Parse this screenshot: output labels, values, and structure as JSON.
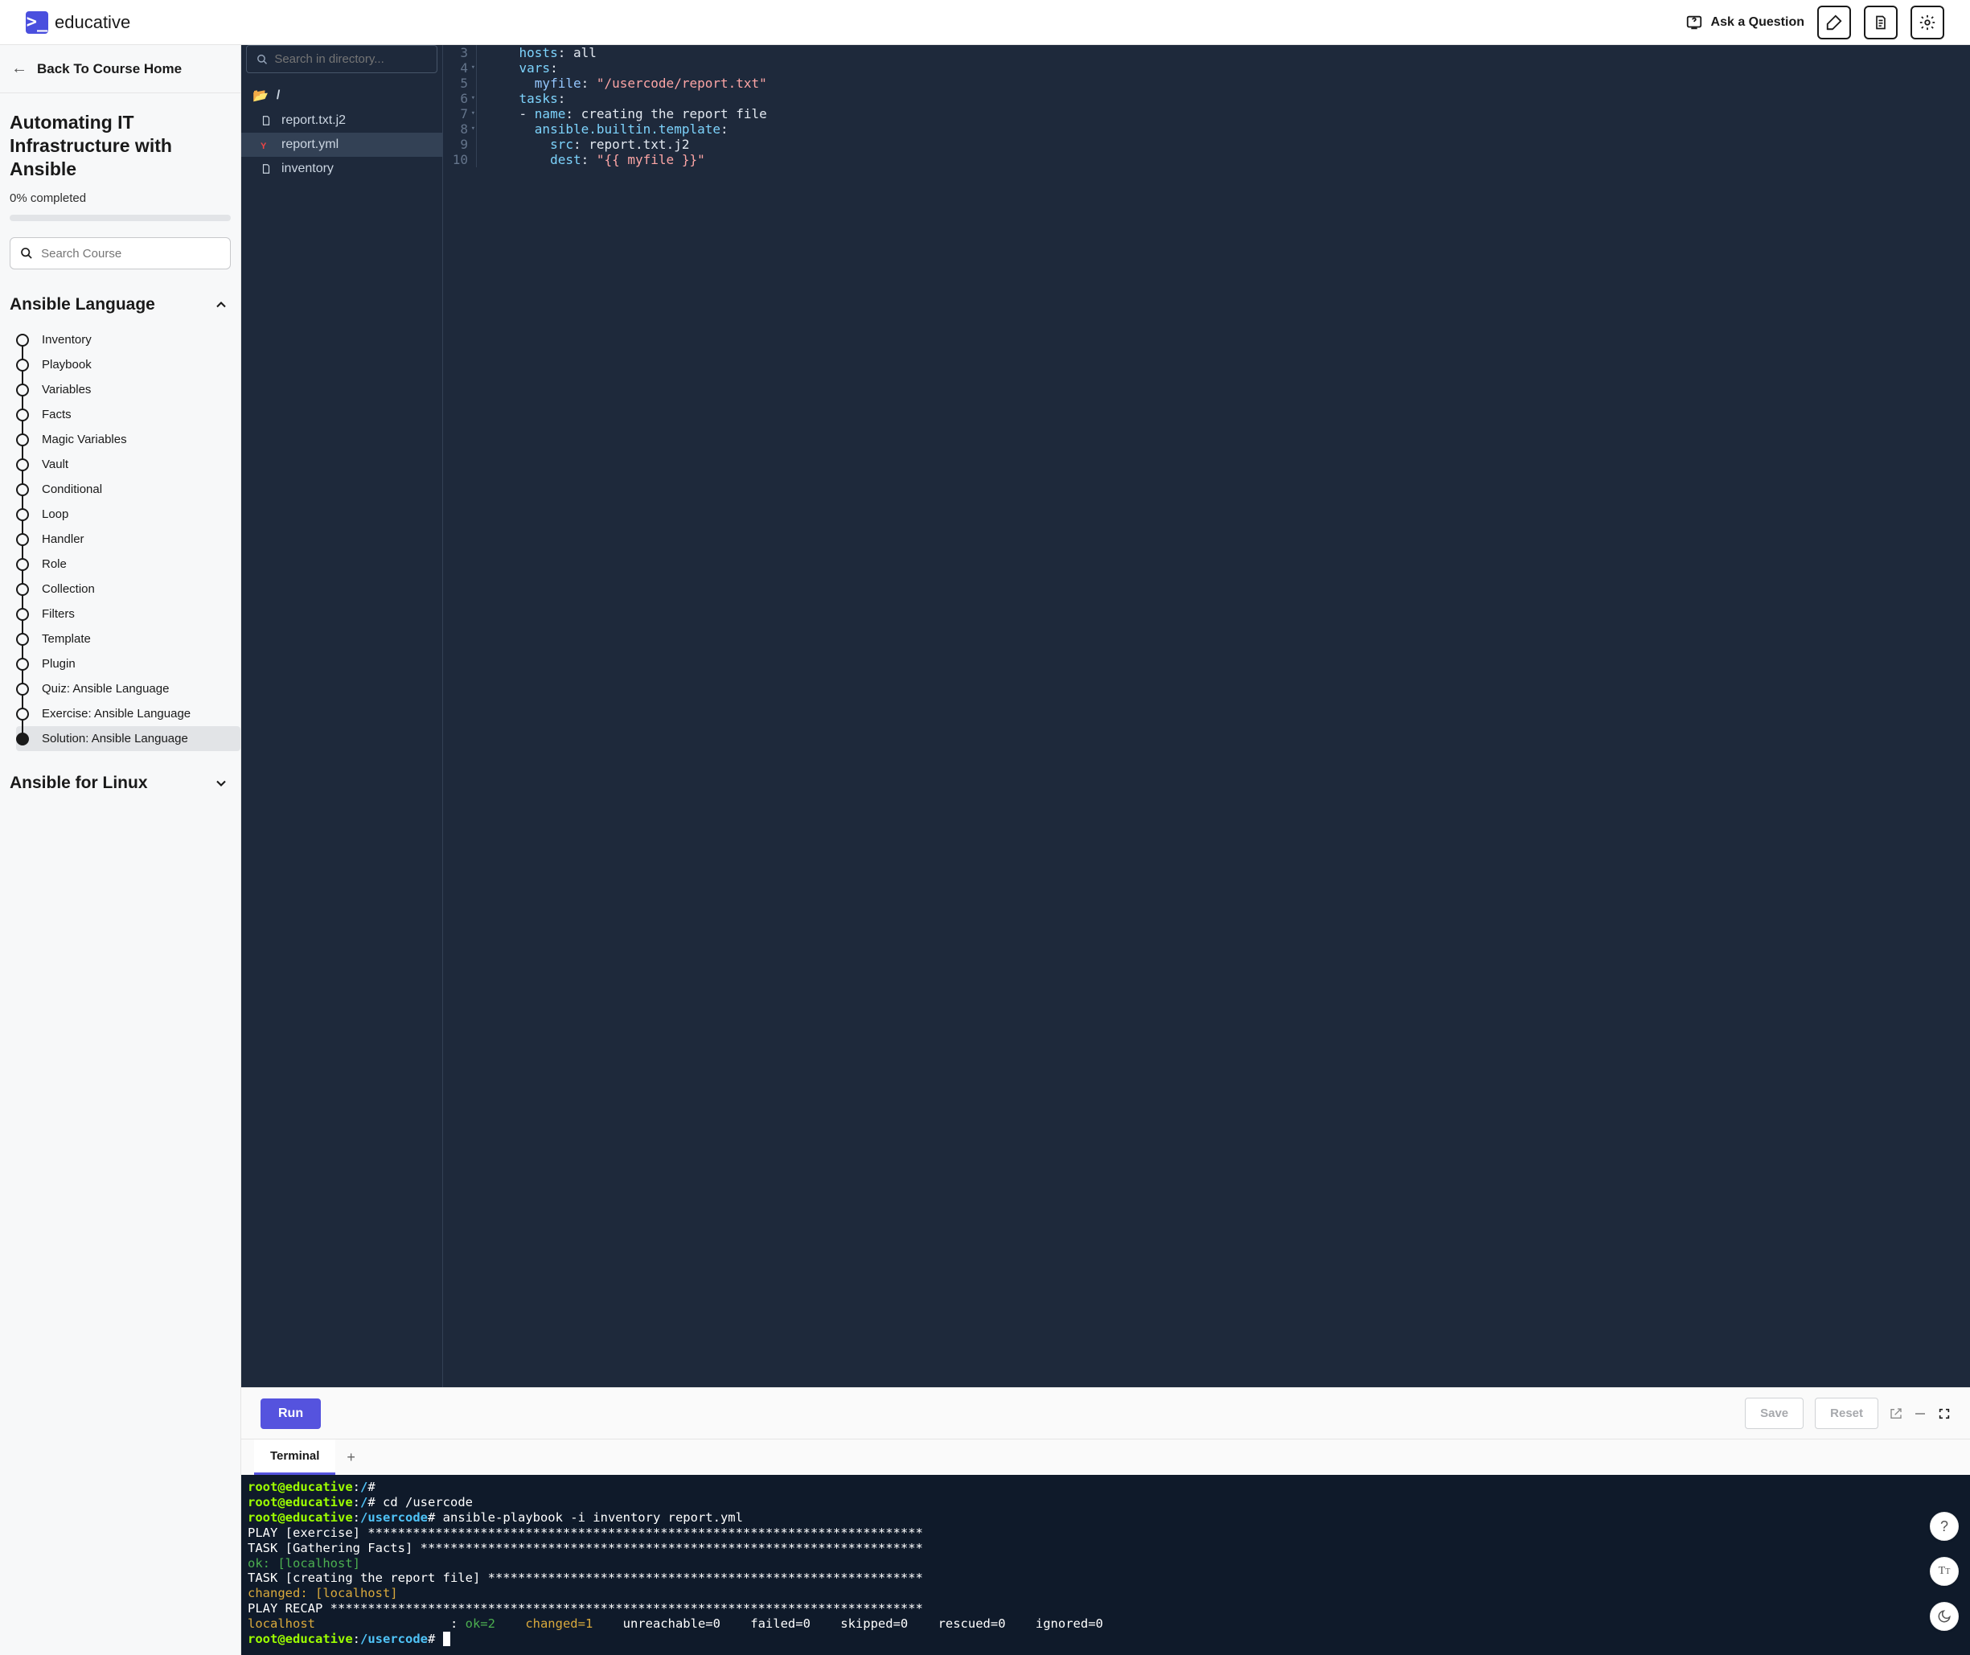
{
  "header": {
    "brand": "educative",
    "ask": "Ask a Question"
  },
  "sidebar": {
    "back": "Back To Course Home",
    "course_title": "Automating IT Infrastructure with Ansible",
    "progress": "0% completed",
    "search_placeholder": "Search Course",
    "sections": [
      {
        "title": "Ansible Language",
        "expanded": true,
        "lessons": [
          {
            "label": "Inventory"
          },
          {
            "label": "Playbook"
          },
          {
            "label": "Variables"
          },
          {
            "label": "Facts"
          },
          {
            "label": "Magic Variables"
          },
          {
            "label": "Vault"
          },
          {
            "label": "Conditional"
          },
          {
            "label": "Loop"
          },
          {
            "label": "Handler"
          },
          {
            "label": "Role"
          },
          {
            "label": "Collection"
          },
          {
            "label": "Filters"
          },
          {
            "label": "Template"
          },
          {
            "label": "Plugin"
          },
          {
            "label": "Quiz: Ansible Language"
          },
          {
            "label": "Exercise: Ansible Language"
          },
          {
            "label": "Solution: Ansible Language",
            "active": true
          }
        ]
      },
      {
        "title": "Ansible for Linux",
        "expanded": false
      }
    ]
  },
  "files": {
    "search_placeholder": "Search in directory...",
    "root": "/",
    "items": [
      {
        "name": "report.txt.j2",
        "icon": "file"
      },
      {
        "name": "report.yml",
        "icon": "yml",
        "active": true
      },
      {
        "name": "inventory",
        "icon": "file"
      }
    ]
  },
  "code": {
    "lines": [
      {
        "n": 3,
        "tokens": [
          {
            "t": "    ",
            "c": "plain"
          },
          {
            "t": "hosts",
            "c": "key"
          },
          {
            "t": ": ",
            "c": "plain"
          },
          {
            "t": "all",
            "c": "plain"
          }
        ]
      },
      {
        "n": 4,
        "fold": true,
        "tokens": [
          {
            "t": "    ",
            "c": "plain"
          },
          {
            "t": "vars",
            "c": "key"
          },
          {
            "t": ":",
            "c": "plain"
          }
        ]
      },
      {
        "n": 5,
        "tokens": [
          {
            "t": "      ",
            "c": "plain"
          },
          {
            "t": "myfile",
            "c": "var"
          },
          {
            "t": ": ",
            "c": "plain"
          },
          {
            "t": "\"/usercode/report.txt\"",
            "c": "str"
          }
        ]
      },
      {
        "n": 6,
        "fold": true,
        "tokens": [
          {
            "t": "    ",
            "c": "plain"
          },
          {
            "t": "tasks",
            "c": "key"
          },
          {
            "t": ":",
            "c": "plain"
          }
        ]
      },
      {
        "n": 7,
        "fold": true,
        "tokens": [
          {
            "t": "    - ",
            "c": "dash"
          },
          {
            "t": "name",
            "c": "key"
          },
          {
            "t": ": ",
            "c": "plain"
          },
          {
            "t": "creating the report file",
            "c": "plain"
          }
        ]
      },
      {
        "n": 8,
        "fold": true,
        "tokens": [
          {
            "t": "      ",
            "c": "plain"
          },
          {
            "t": "ansible.builtin.template",
            "c": "key"
          },
          {
            "t": ":",
            "c": "plain"
          }
        ]
      },
      {
        "n": 9,
        "tokens": [
          {
            "t": "        ",
            "c": "plain"
          },
          {
            "t": "src",
            "c": "key"
          },
          {
            "t": ": ",
            "c": "plain"
          },
          {
            "t": "report.txt.j2",
            "c": "plain"
          }
        ]
      },
      {
        "n": 10,
        "tokens": [
          {
            "t": "        ",
            "c": "plain"
          },
          {
            "t": "dest",
            "c": "key"
          },
          {
            "t": ": ",
            "c": "plain"
          },
          {
            "t": "\"{{ myfile }}\"",
            "c": "str"
          }
        ]
      }
    ]
  },
  "controls": {
    "run": "Run",
    "save": "Save",
    "reset": "Reset"
  },
  "terminal": {
    "tab": "Terminal",
    "lines": [
      {
        "spans": [
          {
            "t": "root@educative",
            "c": "lime"
          },
          {
            "t": ":",
            "c": "white"
          },
          {
            "t": "/",
            "c": "cyan"
          },
          {
            "t": "#",
            "c": "white"
          }
        ]
      },
      {
        "spans": [
          {
            "t": "root@educative",
            "c": "lime"
          },
          {
            "t": ":",
            "c": "white"
          },
          {
            "t": "/",
            "c": "cyan"
          },
          {
            "t": "# cd /usercode",
            "c": "white"
          }
        ]
      },
      {
        "spans": [
          {
            "t": "root@educative",
            "c": "lime"
          },
          {
            "t": ":",
            "c": "white"
          },
          {
            "t": "/usercode",
            "c": "cyan"
          },
          {
            "t": "# ansible-playbook -i inventory report.yml",
            "c": "white"
          }
        ]
      },
      {
        "spans": [
          {
            "t": "",
            "c": "white"
          }
        ]
      },
      {
        "spans": [
          {
            "t": "PLAY [exercise] **************************************************************************",
            "c": "white"
          }
        ]
      },
      {
        "spans": [
          {
            "t": "",
            "c": "white"
          }
        ]
      },
      {
        "spans": [
          {
            "t": "TASK [Gathering Facts] *******************************************************************",
            "c": "white"
          }
        ]
      },
      {
        "spans": [
          {
            "t": "ok: [localhost]",
            "c": "green"
          }
        ]
      },
      {
        "spans": [
          {
            "t": "",
            "c": "white"
          }
        ]
      },
      {
        "spans": [
          {
            "t": "TASK [creating the report file] **********************************************************",
            "c": "white"
          }
        ]
      },
      {
        "spans": [
          {
            "t": "changed: [localhost]",
            "c": "yellow"
          }
        ]
      },
      {
        "spans": [
          {
            "t": "",
            "c": "white"
          }
        ]
      },
      {
        "spans": [
          {
            "t": "PLAY RECAP *******************************************************************************",
            "c": "white"
          }
        ]
      },
      {
        "spans": [
          {
            "t": "localhost",
            "c": "yellow"
          },
          {
            "t": "                  : ",
            "c": "white"
          },
          {
            "t": "ok=2   ",
            "c": "green"
          },
          {
            "t": " ",
            "c": "white"
          },
          {
            "t": "changed=1   ",
            "c": "yellow"
          },
          {
            "t": " unreachable=0    failed=0    skipped=0    rescued=0    ignored=0",
            "c": "white"
          }
        ]
      },
      {
        "spans": [
          {
            "t": "",
            "c": "white"
          }
        ]
      },
      {
        "spans": [
          {
            "t": "root@educative",
            "c": "lime"
          },
          {
            "t": ":",
            "c": "white"
          },
          {
            "t": "/usercode",
            "c": "cyan"
          },
          {
            "t": "# ",
            "c": "white"
          }
        ],
        "cursor": true
      }
    ]
  }
}
